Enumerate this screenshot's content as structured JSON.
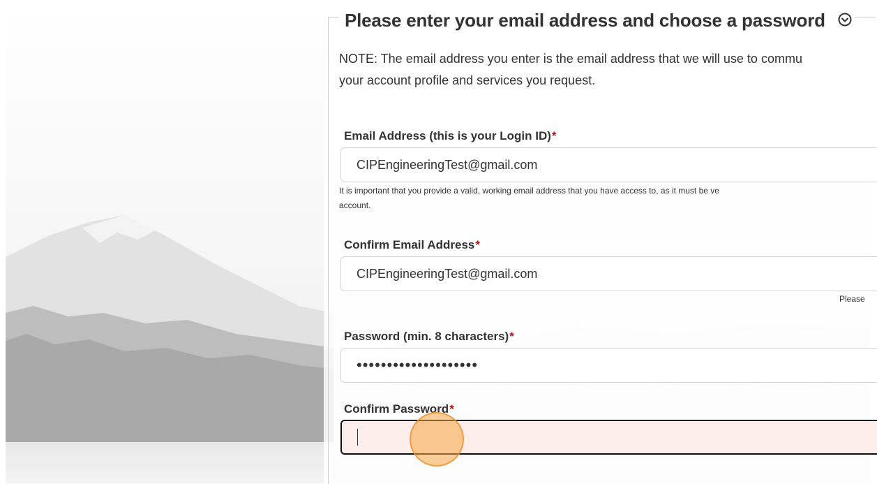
{
  "section": {
    "legend_title": "Please enter your email address and choose a password",
    "collapse_icon": "chevron-circle-down-icon",
    "note_line1": "NOTE: The email address you enter is the email address that we will use to commu",
    "note_line2": "your account profile and services you request."
  },
  "email": {
    "label": "Email Address (this is your Login ID)",
    "required_mark": "*",
    "value": "CIPEngineeringTest@gmail.com",
    "help_line1": "It is important that you provide a valid, working email address that you have access to, as it must be ve",
    "help_line2": "account."
  },
  "confirm_email": {
    "label": "Confirm Email Address",
    "required_mark": "*",
    "value": "CIPEngineeringTest@gmail.com",
    "hint": "Please"
  },
  "password": {
    "label": "Password (min. 8 characters)",
    "required_mark": "*",
    "masked_value": "••••••••••••••••••••"
  },
  "confirm_password": {
    "label": "Confirm Password",
    "required_mark": "*",
    "value": ""
  },
  "colors": {
    "required": "#b5121b",
    "error_bg": "#fdeeec",
    "cursor_highlight": "#f5a646"
  }
}
